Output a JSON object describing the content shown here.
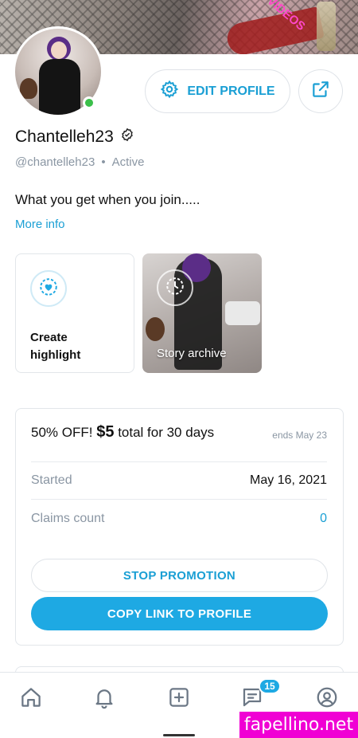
{
  "cover": {
    "watermark_text": "R VIDEOS"
  },
  "profile": {
    "display_name": "Chantelleh23",
    "handle": "@chantelleh23",
    "status": "Active",
    "bio": "What you get when you join.....",
    "more_info": "More info"
  },
  "actions": {
    "edit_profile": "EDIT PROFILE"
  },
  "highlights": [
    {
      "label": "Create highlight"
    },
    {
      "label": "Story archive"
    }
  ],
  "promotion": {
    "title_prefix": "50% OFF!",
    "price": "$5",
    "title_suffix": "total for 30 days",
    "ends": "ends May 23",
    "rows": [
      {
        "label": "Started",
        "value": "May 16, 2021"
      },
      {
        "label": "Claims count",
        "value": "0"
      }
    ],
    "stop_label": "STOP PROMOTION",
    "copy_label": "COPY LINK TO PROFILE"
  },
  "tabbar": {
    "messages_badge": "15"
  },
  "watermark": "fapellino.net",
  "colors": {
    "accent": "#1ea9e3",
    "link": "#1a9fd4",
    "online": "#3bbf4a",
    "muted": "#8a96a3",
    "watermark_bg": "#f000d4"
  }
}
